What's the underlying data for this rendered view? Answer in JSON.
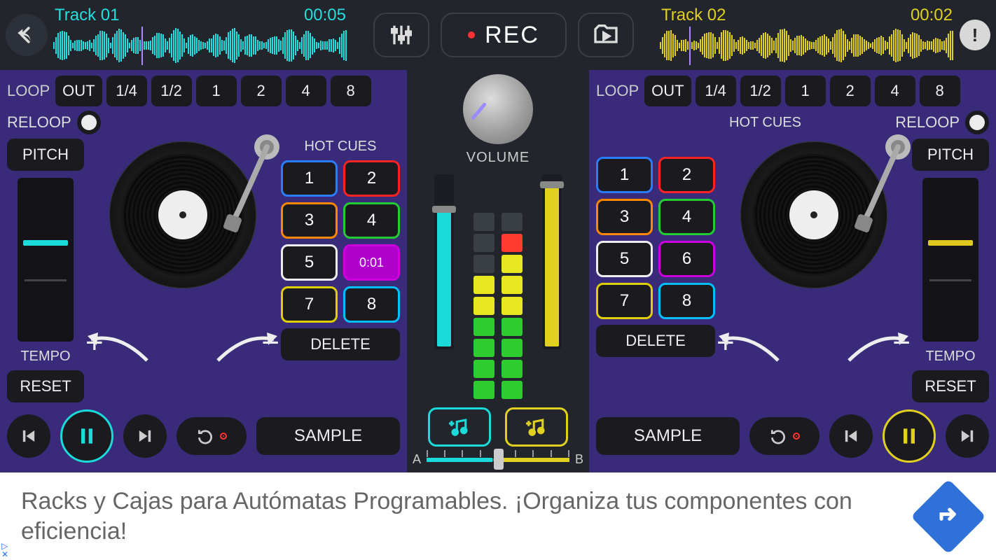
{
  "topbar": {
    "eq_label": "",
    "rec_label": "REC"
  },
  "deck_a": {
    "track_name": "Track 01",
    "track_time": "00:05",
    "loop_label": "LOOP",
    "loop_buttons": [
      "OUT",
      "1/4",
      "1/2",
      "1",
      "2",
      "4",
      "8"
    ],
    "reloop_label": "RELOOP",
    "pitch_label": "PITCH",
    "tempo_label": "TEMPO",
    "reset_label": "RESET",
    "hotcues_label": "HOT CUES",
    "hotcues": [
      "1",
      "2",
      "3",
      "4",
      "5",
      "0:01",
      "7",
      "8"
    ],
    "delete_label": "DELETE",
    "sample_label": "SAMPLE",
    "accent": "#1adada"
  },
  "deck_b": {
    "track_name": "Track 02",
    "track_time": "00:02",
    "loop_label": "LOOP",
    "loop_buttons": [
      "OUT",
      "1/4",
      "1/2",
      "1",
      "2",
      "4",
      "8"
    ],
    "reloop_label": "RELOOP",
    "pitch_label": "PITCH",
    "tempo_label": "TEMPO",
    "reset_label": "RESET",
    "hotcues_label": "HOT CUES",
    "hotcues": [
      "1",
      "2",
      "3",
      "4",
      "5",
      "6",
      "7",
      "8"
    ],
    "delete_label": "DELETE",
    "sample_label": "SAMPLE",
    "accent": "#e0d020"
  },
  "mixer": {
    "volume_label": "VOLUME",
    "crossfader_a": "A",
    "crossfader_b": "B"
  },
  "ad": {
    "text": "Racks y Cajas para Autómatas Programables. ¡Organiza tus componentes con eficiencia!",
    "corner1": "▷",
    "corner2": "✕"
  }
}
